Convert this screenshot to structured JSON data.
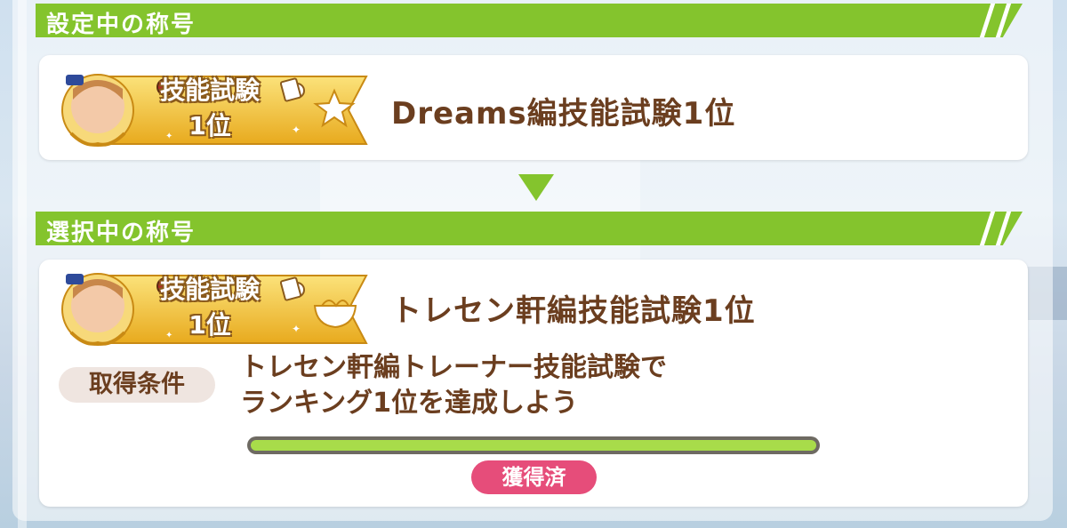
{
  "current_section": {
    "header": "設定中の称号",
    "badge_text_line1": "技能試験",
    "badge_text_line2": "1位",
    "title": "Dreams編技能試験1位"
  },
  "selected_section": {
    "header": "選択中の称号",
    "badge_text_line1": "技能試験",
    "badge_text_line2": "1位",
    "title": "トレセン軒編技能試験1位",
    "condition_label": "取得条件",
    "condition_line1": "トレセン軒編トレーナー技能試験で",
    "condition_line2": "ランキング1位を達成しよう",
    "progress_fraction": 1.0,
    "status": "獲得済"
  },
  "icons": {
    "current_badge_emblem": "star-icon",
    "selected_badge_emblem": "ramen-bowl-icon",
    "arrow": "down-arrow-icon"
  },
  "colors": {
    "header_green": "#84c42d",
    "title_brown": "#6b3e1f",
    "status_pink": "#e64d7a",
    "progress_green": "#a8dc4a",
    "badge_gold": "#f2c230"
  }
}
